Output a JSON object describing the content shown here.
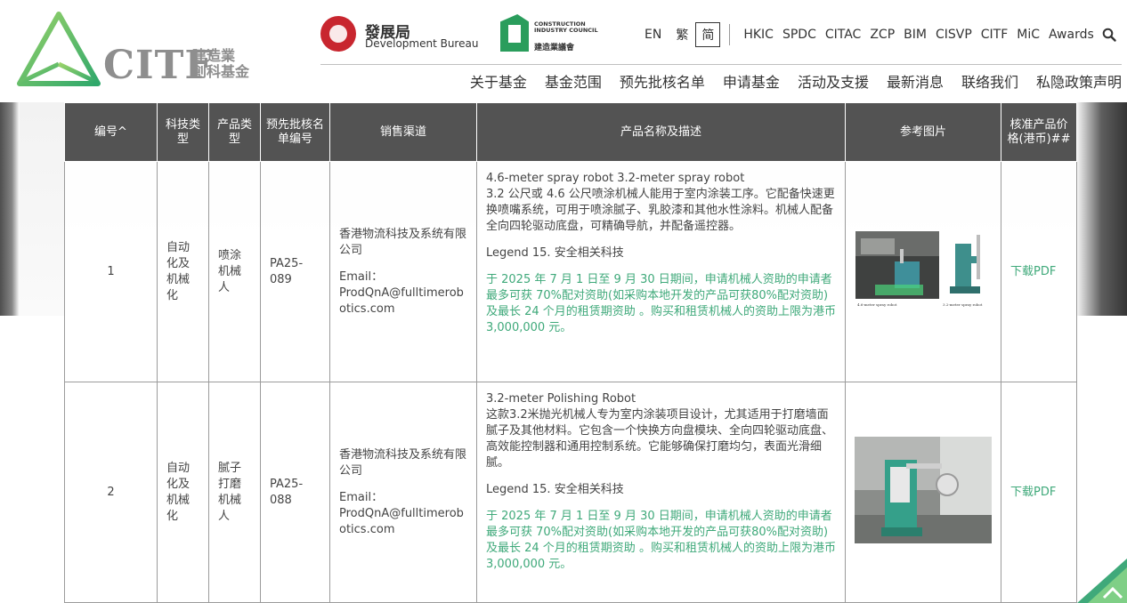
{
  "header": {
    "logo_text": "CITF",
    "logo_cn_line1": "建造業",
    "logo_cn_line2": "創科基金",
    "devb_cn": "發展局",
    "devb_en": "Development Bureau",
    "cic_en_line1": "CONSTRUCTION",
    "cic_en_line2": "INDUSTRY COUNCIL",
    "cic_cn": "建造業議會",
    "languages": [
      "EN",
      "繁",
      "简"
    ],
    "active_language": "简",
    "site_links": [
      "HKIC",
      "SPDC",
      "CITAC",
      "ZCP",
      "BIM",
      "CISVP",
      "CITF",
      "MiC",
      "Awards"
    ],
    "main_nav": [
      "关于基金",
      "基金范围",
      "预先批核名单",
      "申请基金",
      "活动及支援",
      "最新消息",
      "联络我们",
      "私隐政策声明"
    ]
  },
  "table": {
    "headers": {
      "id": "编号^",
      "tech_type": "科技类型",
      "product_type": "产品类型",
      "list_no": "预先批核名单编号",
      "channel": "销售渠道",
      "desc": "产品名称及描述",
      "image": "参考图片",
      "price": "核准产品价格(港币)##"
    },
    "rows": [
      {
        "id": "1",
        "tech_type": "自动化及机械化",
        "product_type": "喷涂机械人",
        "list_no": "PA25-089",
        "channel_company": "香港物流科技及系统有限公司",
        "email_label": "Email：",
        "email": "ProdQnA@fulltimerobotics.com",
        "desc_title": "4.6-meter spray robot 3.2-meter spray robot",
        "desc_body": "3.2 公尺或 4.6 公尺喷涂机械人能用于室内涂装工序。它配备快速更换喷嘴系统，可用于喷涂腻子、乳胶漆和其他水性涂料。机械人配备全向四轮驱动底盘，可精确导航，并配备遥控器。",
        "legend": "Legend 15. 安全相关科技",
        "note": "于 2025 年 7 月 1 日至 9 月 30 日期间，申请机械人资助的申请者最多可获 70%配对资助(如采购本地开发的产品可获80%配对资助)及最长 24 个月的租赁期资助 。购买和租赁机械人的资助上限为港币 3,000,000 元。",
        "img_caption_left": "4.6-meter spray robot",
        "img_caption_right": "3.2-meter spray robot",
        "price_link": "下载PDF"
      },
      {
        "id": "2",
        "tech_type": "自动化及机械化",
        "product_type": "腻子打磨机械人",
        "list_no": "PA25-088",
        "channel_company": "香港物流科技及系统有限公司",
        "email_label": "Email：",
        "email": "ProdQnA@fulltimerobotics.com",
        "desc_title": "3.2-meter Polishing Robot",
        "desc_body": "这款3.2米抛光机械人专为室内涂装项目设计，尤其适用于打磨墙面腻子及其他材料。它包含一个快换方向盘模块、全向四轮驱动底盘、高效能控制器和通用控制系统。它能够确保打磨均匀，表面光滑细腻。",
        "legend": "Legend 15. 安全相关科技",
        "note": "于 2025 年 7 月 1 日至 9 月 30 日期间，申请机械人资助的申请者最多可获 70%配对资助(如采购本地开发的产品可获80%配对资助)及最长 24 个月的租赁期资助 。购买和租赁机械人的资助上限为港币 3,000,000 元。",
        "price_link": "下载PDF"
      }
    ]
  },
  "colors": {
    "accent_green": "#3fa97a",
    "header_gray": "#535353",
    "devb_red": "#c8262f"
  }
}
